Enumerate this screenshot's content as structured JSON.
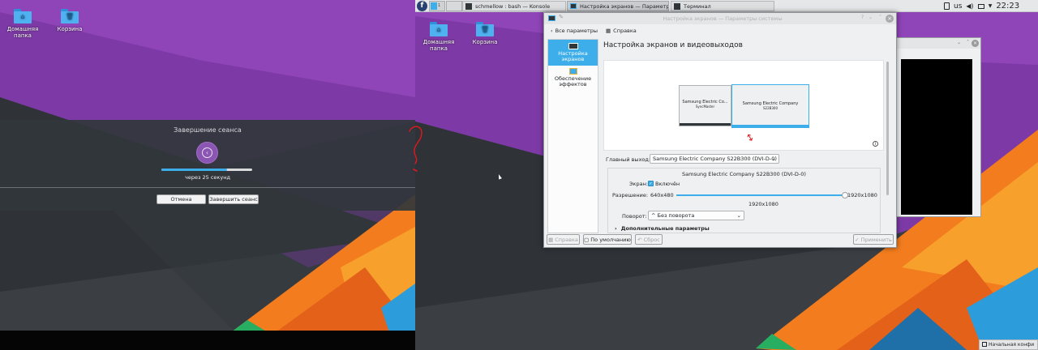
{
  "desktop": {
    "icons": [
      {
        "label": "Домашняя папка",
        "icon": "home-folder-icon"
      },
      {
        "label": "Корзина",
        "icon": "trash-icon"
      }
    ]
  },
  "logout_dialog": {
    "title": "Завершение сеанса",
    "countdown": "через 25 секунд",
    "progress": 0.72,
    "cancel_label": "Отмена",
    "confirm_label": "Завершить сеанс"
  },
  "annotation": {
    "mark": "?",
    "color": "#e0191f"
  },
  "taskbar": {
    "tasks": [
      {
        "label": "schmellow : bash — Konsole"
      },
      {
        "label": "Настройка экранов — Параметры системы"
      },
      {
        "label": "Терминал"
      }
    ],
    "layout": "us",
    "clock": "22:23",
    "pager_desktop": "1"
  },
  "settings_window": {
    "title": "Настройка экранов — Параметры системы",
    "back_label": "Все параметры",
    "help_label": "Справка",
    "sidebar": [
      {
        "label": "Настройка экранов",
        "active": true
      },
      {
        "label": "Обеспечение эффектов",
        "active": false
      }
    ],
    "heading": "Настройка экранов и видеовыходов",
    "monitor_left": {
      "name": "Samsung Electric Co...",
      "sub": "SyncMaster"
    },
    "monitor_right": {
      "name": "Samsung Electric Company",
      "sub": "S22B300"
    },
    "primary_output_label": "Главный выход:",
    "primary_output_value": "Samsung Electric Company S22B300 (DVI-D-0)",
    "output_title": "Samsung Electric Company S22B300 (DVI-D-0)",
    "screen_label": "Экран:",
    "enabled_label": "Включён",
    "enabled": true,
    "resolution_label": "Разрешение:",
    "res_min": "640x480",
    "res_max": "1920x1080",
    "res_current": "1920x1080",
    "res_value": 1.0,
    "rotation_label": "Поворот:",
    "rotation_value": "Без поворота",
    "advanced_label": "Дополнительные параметры",
    "footer": {
      "help": "Справка",
      "defaults": "По умолчанию",
      "reset": "Сброс",
      "apply": "Применить"
    }
  },
  "notification": {
    "label": "Начальная конфи"
  },
  "colors": {
    "accent": "#3daee9",
    "purple": "#7a3aa0",
    "orange": "#f27c1e"
  }
}
